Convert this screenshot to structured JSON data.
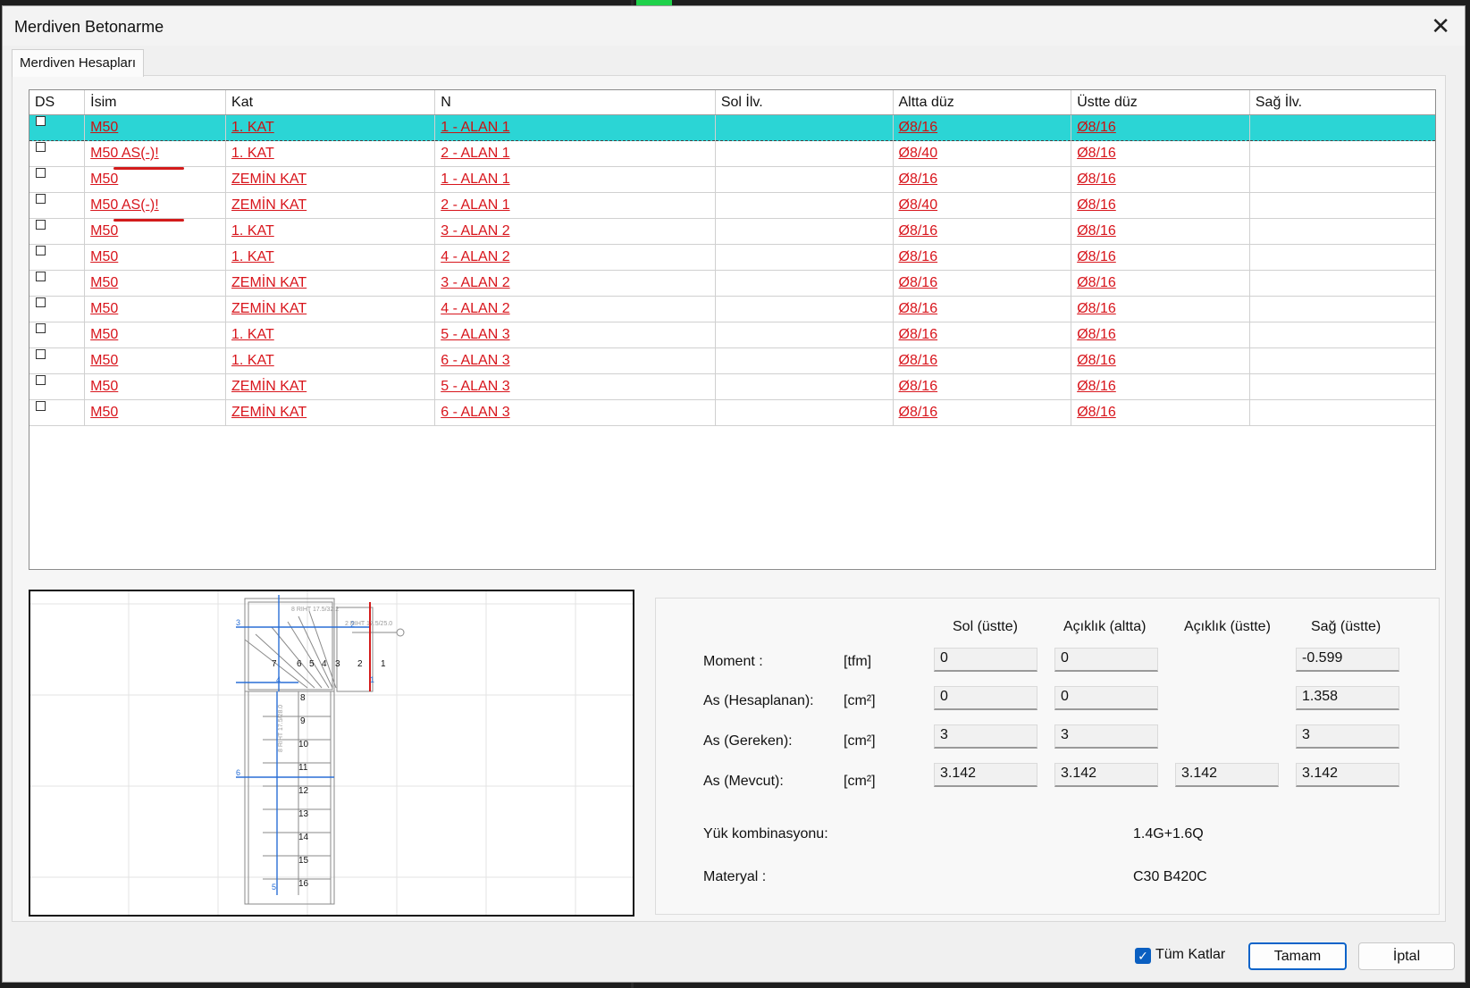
{
  "window": {
    "title": "Merdiven Betonarme",
    "close_glyph": "✕"
  },
  "tab": {
    "label": "Merdiven Hesapları"
  },
  "table": {
    "columns": [
      "DS",
      "İsim",
      "Kat",
      "N",
      "Sol İlv.",
      "Altta düz",
      "Üstte düz",
      "Sağ İlv."
    ],
    "rows": [
      {
        "isim": "M50",
        "kat": "1. KAT",
        "n": "1 - ALAN 1",
        "sol": "",
        "altta": "Ø8/16",
        "ustte": "Ø8/16",
        "sag": "",
        "selected": true
      },
      {
        "isim": "M50 AS(-)!",
        "kat": "1. KAT",
        "n": "2 - ALAN 1",
        "sol": "",
        "altta": "Ø8/40",
        "ustte": "Ø8/16",
        "sag": ""
      },
      {
        "isim": "M50",
        "kat": "ZEMİN KAT",
        "n": "1 - ALAN 1",
        "sol": "",
        "altta": "Ø8/16",
        "ustte": "Ø8/16",
        "sag": ""
      },
      {
        "isim": "M50 AS(-)!",
        "kat": "ZEMİN KAT",
        "n": "2 - ALAN 1",
        "sol": "",
        "altta": "Ø8/40",
        "ustte": "Ø8/16",
        "sag": ""
      },
      {
        "isim": "M50",
        "kat": "1. KAT",
        "n": "3 - ALAN 2",
        "sol": "",
        "altta": "Ø8/16",
        "ustte": "Ø8/16",
        "sag": ""
      },
      {
        "isim": "M50",
        "kat": "1. KAT",
        "n": "4 - ALAN 2",
        "sol": "",
        "altta": "Ø8/16",
        "ustte": "Ø8/16",
        "sag": ""
      },
      {
        "isim": "M50",
        "kat": "ZEMİN KAT",
        "n": "3 - ALAN 2",
        "sol": "",
        "altta": "Ø8/16",
        "ustte": "Ø8/16",
        "sag": ""
      },
      {
        "isim": "M50",
        "kat": "ZEMİN KAT",
        "n": "4 - ALAN 2",
        "sol": "",
        "altta": "Ø8/16",
        "ustte": "Ø8/16",
        "sag": ""
      },
      {
        "isim": "M50",
        "kat": "1. KAT",
        "n": "5 - ALAN 3",
        "sol": "",
        "altta": "Ø8/16",
        "ustte": "Ø8/16",
        "sag": ""
      },
      {
        "isim": "M50",
        "kat": "1. KAT",
        "n": "6 - ALAN 3",
        "sol": "",
        "altta": "Ø8/16",
        "ustte": "Ø8/16",
        "sag": ""
      },
      {
        "isim": "M50",
        "kat": "ZEMİN KAT",
        "n": "5 - ALAN 3",
        "sol": "",
        "altta": "Ø8/16",
        "ustte": "Ø8/16",
        "sag": ""
      },
      {
        "isim": "M50",
        "kat": "ZEMİN KAT",
        "n": "6 - ALAN 3",
        "sol": "",
        "altta": "Ø8/16",
        "ustte": "Ø8/16",
        "sag": ""
      }
    ]
  },
  "results": {
    "headers": [
      "Sol (üstte)",
      "Açıklık (altta)",
      "Açıklık (üstte)",
      "Sağ (üstte)"
    ],
    "rows": [
      {
        "label": "Moment :",
        "unit": "[tfm]",
        "values": [
          "0",
          "0",
          null,
          "-0.599"
        ]
      },
      {
        "label": "As (Hesaplanan):",
        "unit": "[cm²]",
        "values": [
          "0",
          "0",
          null,
          "1.358"
        ]
      },
      {
        "label": "As (Gereken):",
        "unit": "[cm²]",
        "values": [
          "3",
          "3",
          null,
          "3"
        ]
      },
      {
        "label": "As (Mevcut):",
        "unit": "[cm²]",
        "values": [
          "3.142",
          "3.142",
          "3.142",
          "3.142"
        ]
      }
    ],
    "load_combination": {
      "label": "Yük kombinasyonu:",
      "value": "1.4G+1.6Q"
    },
    "material": {
      "label": "Materyal :",
      "value": "C30 B420C"
    }
  },
  "drawing": {
    "step_numbers": [
      "7",
      "6",
      "5",
      "4",
      "3",
      "2",
      "1",
      "8",
      "9",
      "10",
      "11",
      "12",
      "13",
      "14",
      "15",
      "16"
    ],
    "axis_markers": [
      "3",
      "4",
      "6",
      "5",
      "1",
      "2"
    ],
    "riser_labels": [
      "8 RIHT 17.5/32.2",
      "2 RIHT 17.5/25.0",
      "8 RIHT 17.5/28.0"
    ]
  },
  "footer": {
    "all_floors_label": "Tüm Katlar",
    "all_floors_checked": true,
    "ok_label": "Tamam",
    "cancel_label": "İptal"
  },
  "colors": {
    "selection": "#2bd5d5",
    "link_red": "#d8151c",
    "accent_blue": "#0a63c9"
  }
}
